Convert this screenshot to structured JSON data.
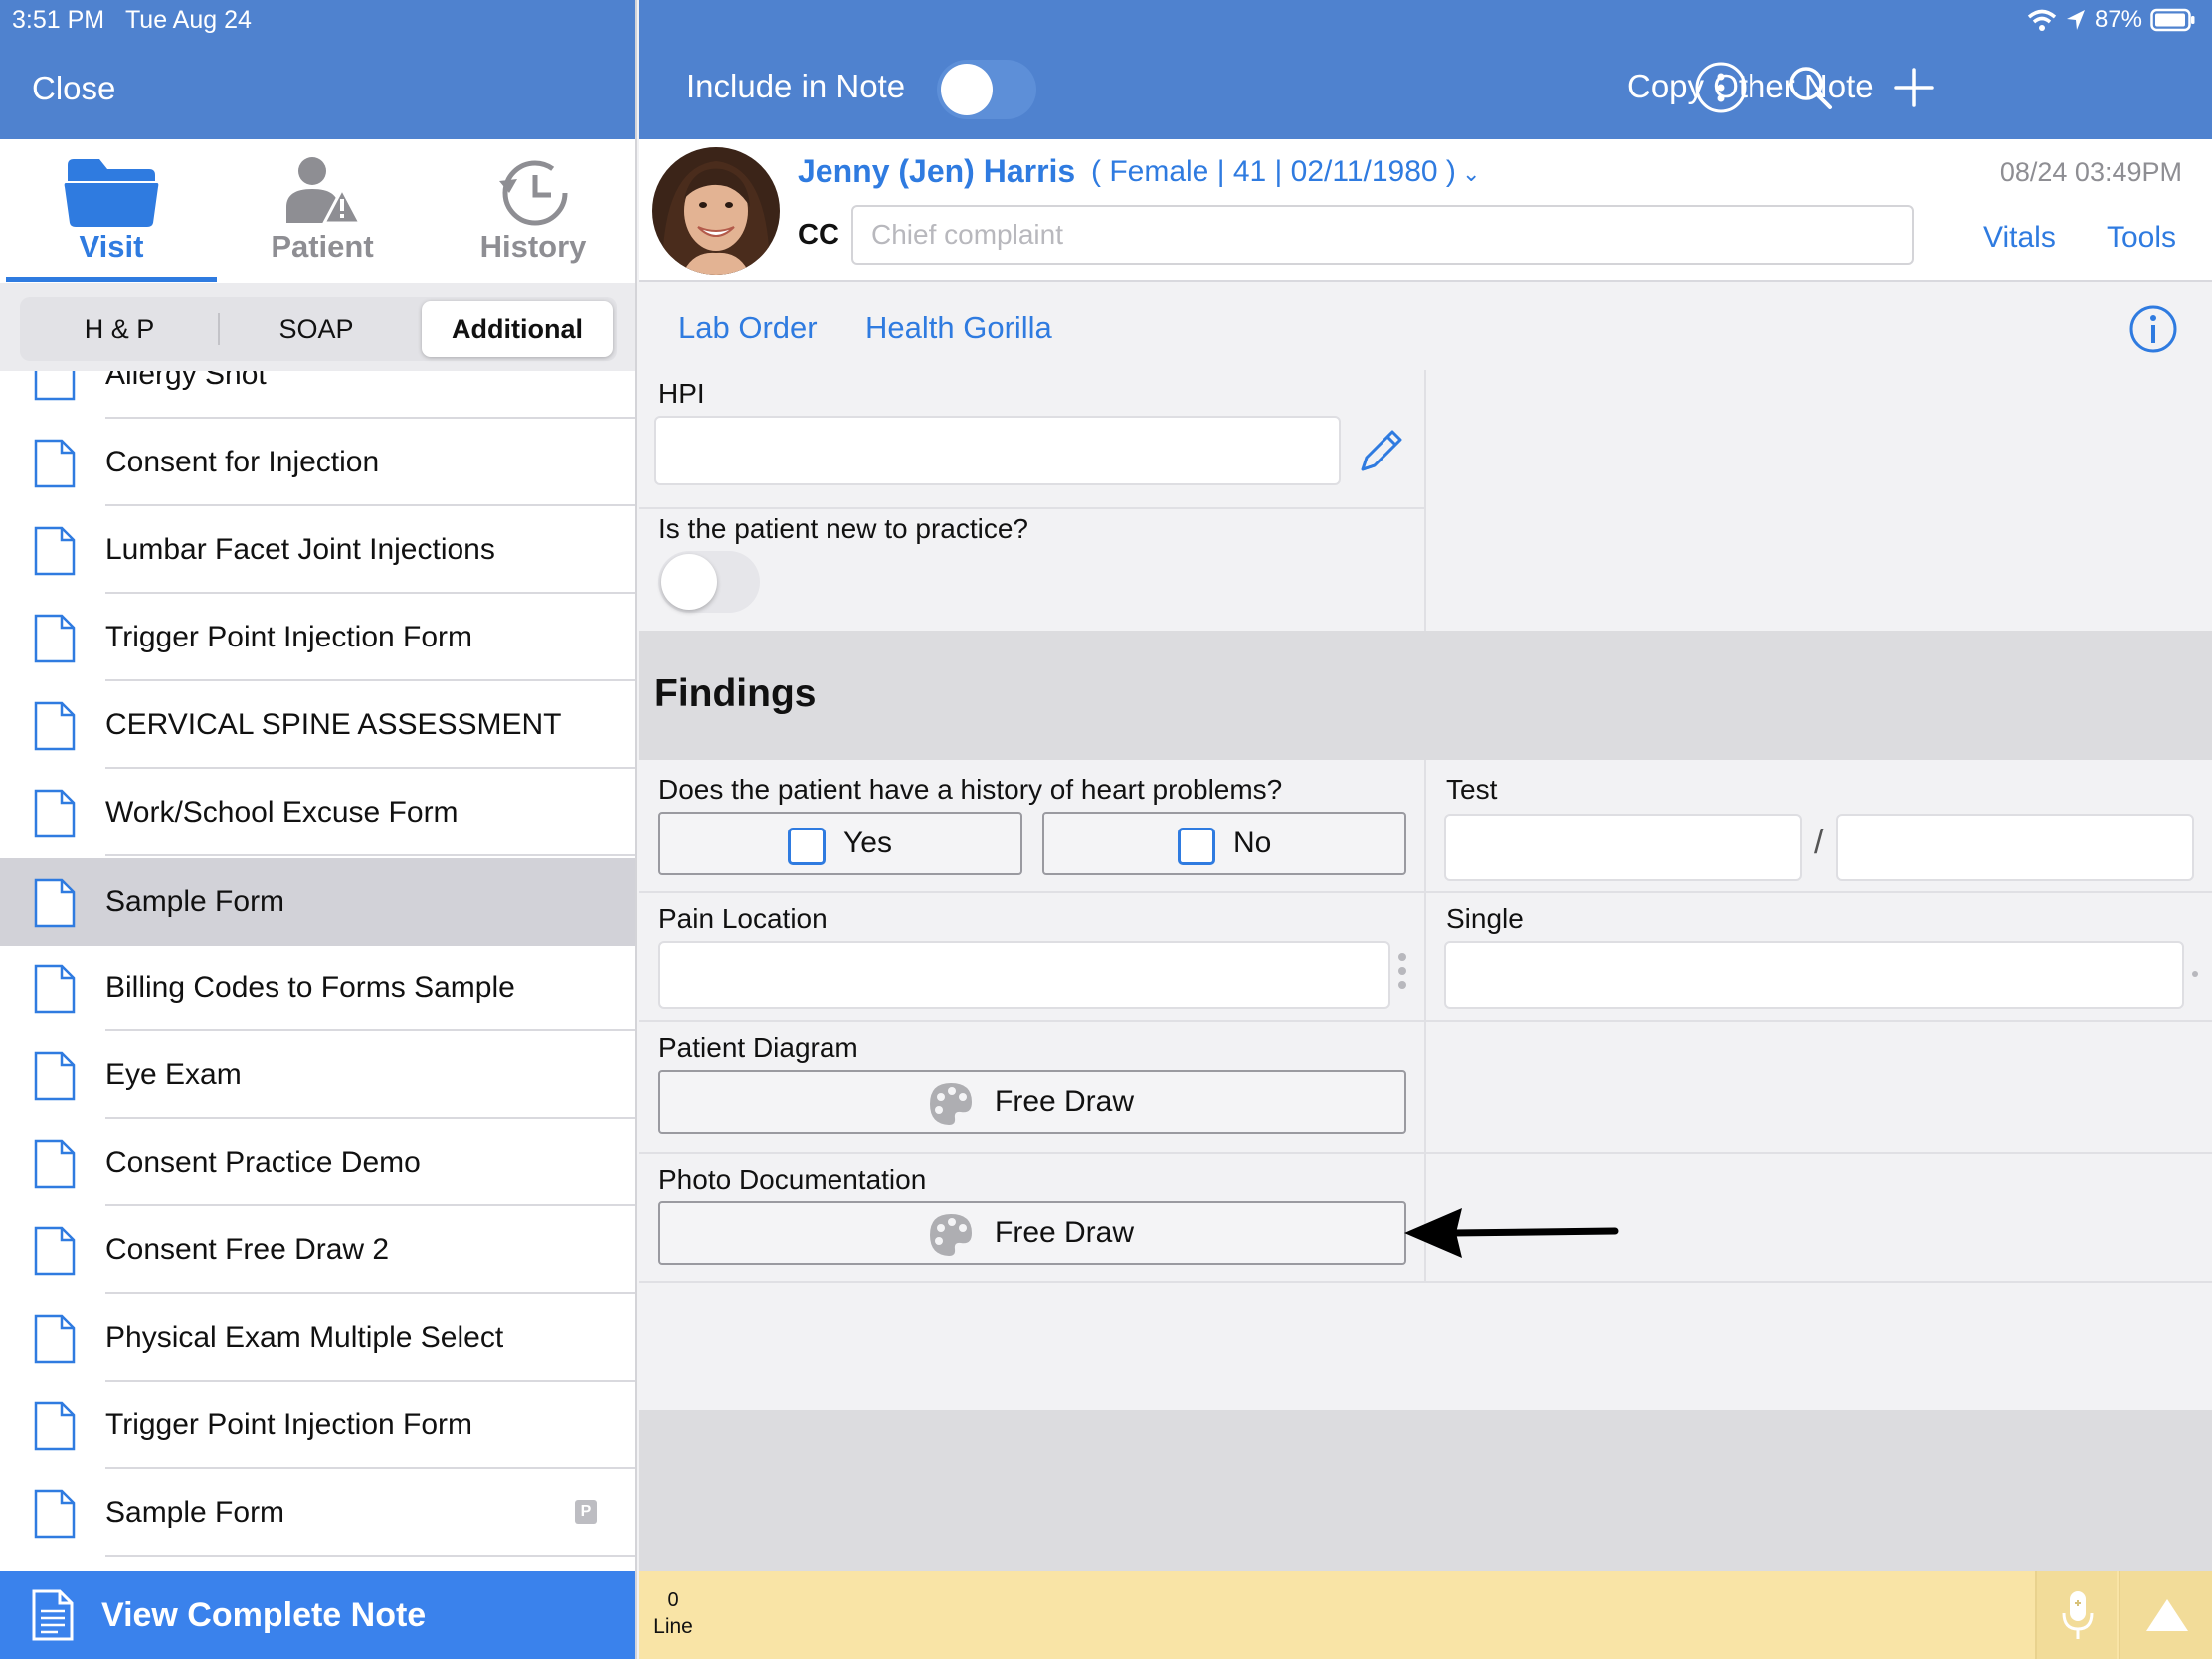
{
  "status_bar": {
    "time": "3:51 PM",
    "date": "Tue Aug 24",
    "battery": "87%"
  },
  "left_header": {
    "close_label": "Close"
  },
  "tabs": [
    {
      "label": "Visit",
      "icon": "folder-icon",
      "active": true
    },
    {
      "label": "Patient",
      "icon": "patient-alert-icon",
      "active": false
    },
    {
      "label": "History",
      "icon": "history-clock-icon",
      "active": false
    }
  ],
  "segments": [
    {
      "label": "H & P",
      "active": false
    },
    {
      "label": "SOAP",
      "active": false
    },
    {
      "label": "Additional",
      "active": true
    }
  ],
  "forms": [
    {
      "label": "Allergy Shot"
    },
    {
      "label": "Consent for Injection"
    },
    {
      "label": "Lumbar Facet Joint Injections"
    },
    {
      "label": "Trigger Point Injection Form"
    },
    {
      "label": "CERVICAL SPINE ASSESSMENT"
    },
    {
      "label": "Work/School Excuse Form"
    },
    {
      "label": "Sample Form",
      "selected": true
    },
    {
      "label": "Billing Codes to Forms Sample"
    },
    {
      "label": "Eye Exam"
    },
    {
      "label": "Consent Practice Demo"
    },
    {
      "label": "Consent Free Draw 2"
    },
    {
      "label": "Physical Exam Multiple Select"
    },
    {
      "label": "Trigger Point Injection Form"
    },
    {
      "label": "Sample Form",
      "badge": "P"
    }
  ],
  "view_note": {
    "label": "View Complete Note"
  },
  "right_header": {
    "include_label": "Include in Note",
    "include_on": false,
    "copy_label": "Copy Other Note"
  },
  "patient": {
    "name": "Jenny (Jen) Harris",
    "demographics": "( Female | 41 | 02/11/1980 )",
    "visit_datetime": "08/24 03:49PM",
    "cc_label": "CC",
    "cc_placeholder": "Chief complaint",
    "cc_value": ""
  },
  "patient_links": {
    "vitals": "Vitals",
    "tools": "Tools"
  },
  "links": {
    "lab_order": "Lab Order",
    "health_gorilla": "Health Gorilla"
  },
  "form": {
    "hpi_label": "HPI",
    "new_patient_question": "Is the patient new to practice?",
    "new_patient_on": false,
    "findings_title": "Findings",
    "heart_question": "Does the patient have a history of heart problems?",
    "yes_label": "Yes",
    "no_label": "No",
    "test_label": "Test",
    "test_sep": "/",
    "pain_location_label": "Pain Location",
    "single_label": "Single",
    "patient_diagram_label": "Patient Diagram",
    "photo_doc_label": "Photo Documentation",
    "free_draw_label": "Free Draw"
  },
  "bottom": {
    "line_count": "0",
    "line_label": "Line"
  },
  "colors": {
    "header_blue": "#4f82cf",
    "link_blue": "#2f7be0",
    "note_bar": "#f9e4a6",
    "view_note_blue": "#3a82ec"
  }
}
